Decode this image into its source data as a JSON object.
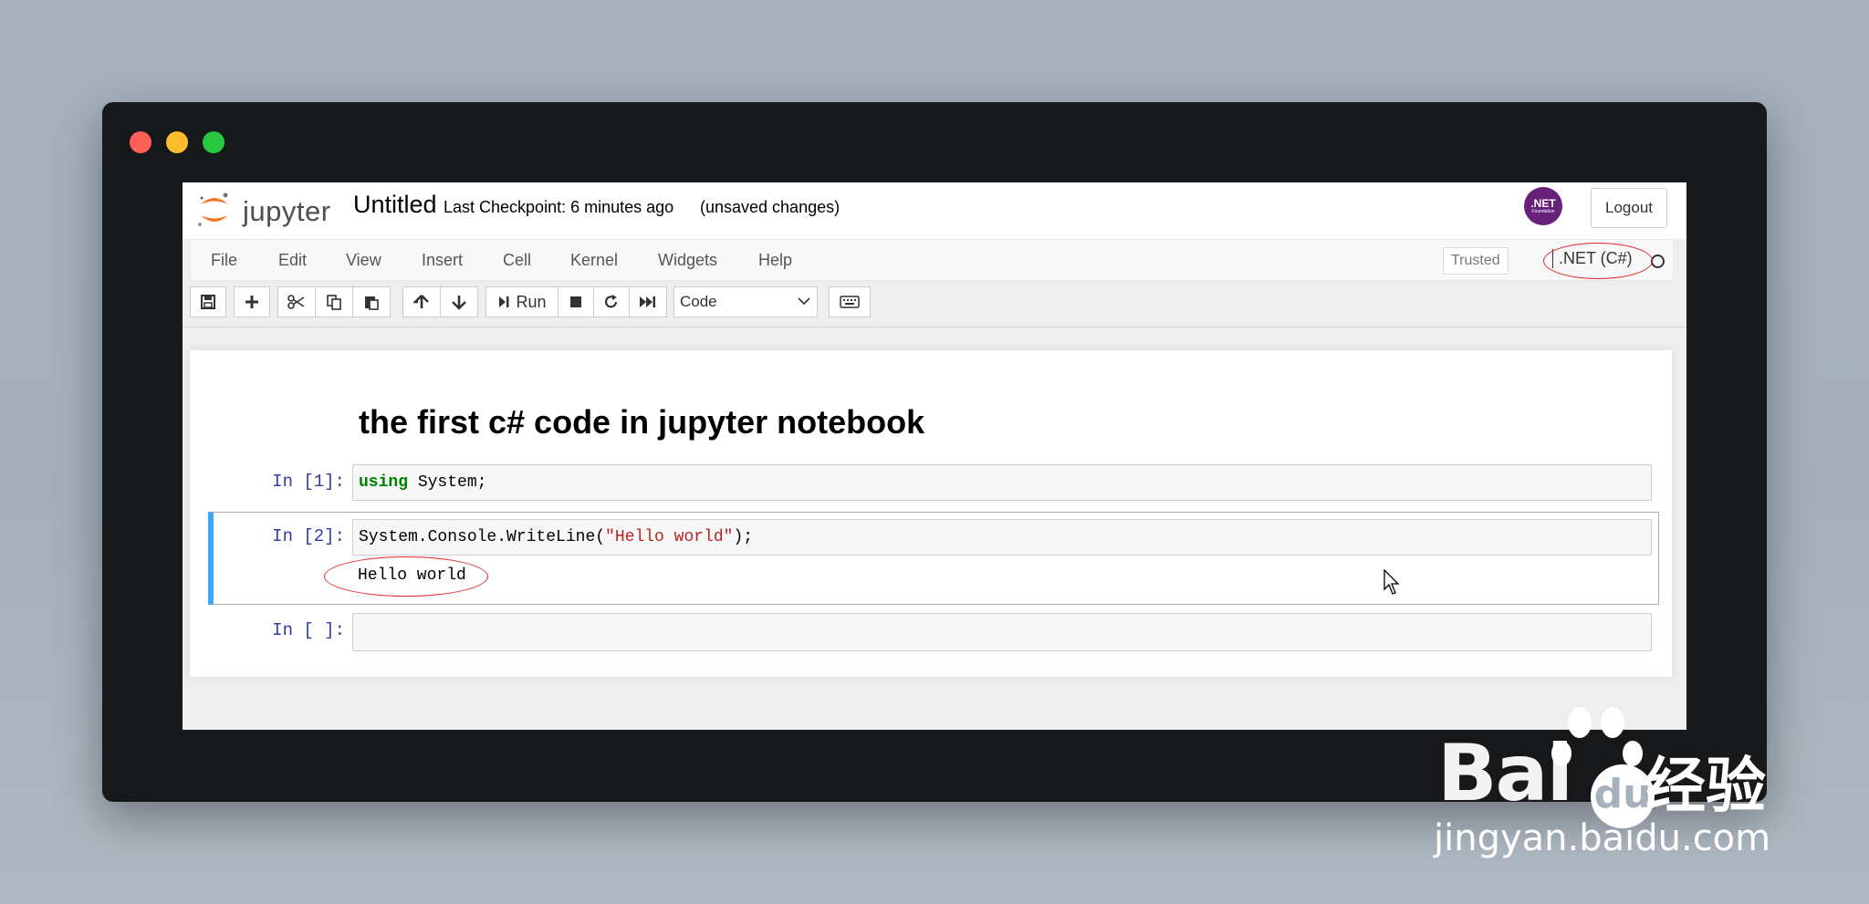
{
  "header": {
    "logo_text": "jupyter",
    "notebook_name": "Untitled",
    "checkpoint": "Last Checkpoint: 6 minutes ago",
    "save_status": "(unsaved changes)",
    "net_logo_text": ".NET",
    "net_logo_sub": "Foundation",
    "logout_label": "Logout"
  },
  "menubar": {
    "items": [
      "File",
      "Edit",
      "View",
      "Insert",
      "Cell",
      "Kernel",
      "Widgets",
      "Help"
    ],
    "trusted_label": "Trusted",
    "kernel_name": ".NET (C#)"
  },
  "toolbar": {
    "run_label": "Run",
    "cell_type": "Code",
    "icons": [
      "save-icon",
      "plus-icon",
      "scissors-icon",
      "copy-icon",
      "paste-icon",
      "arrow-up-icon",
      "arrow-down-icon",
      "run-icon",
      "stop-icon",
      "restart-icon",
      "fast-forward-icon",
      "keyboard-icon"
    ]
  },
  "notebook": {
    "heading": "the first c# code in jupyter notebook",
    "cells": [
      {
        "prompt": "In [1]:",
        "code_keyword": "using",
        "code_rest": " System;"
      },
      {
        "prompt": "In [2]:",
        "code_prefix": "System.Console.WriteLine(",
        "code_string": "\"Hello world\"",
        "code_suffix": ");",
        "output": "Hello world"
      },
      {
        "prompt": "In [ ]:",
        "code": ""
      }
    ]
  },
  "watermark": {
    "brand_latin": "Bai",
    "brand_du": "du",
    "brand_cn": "经验",
    "url": "jingyan.baidu.com"
  },
  "colors": {
    "annotation": "#e0262a",
    "selected_cell_border": "#42a5f5",
    "prompt": "#303f9f",
    "keyword": "#008000",
    "string": "#ba2121"
  }
}
